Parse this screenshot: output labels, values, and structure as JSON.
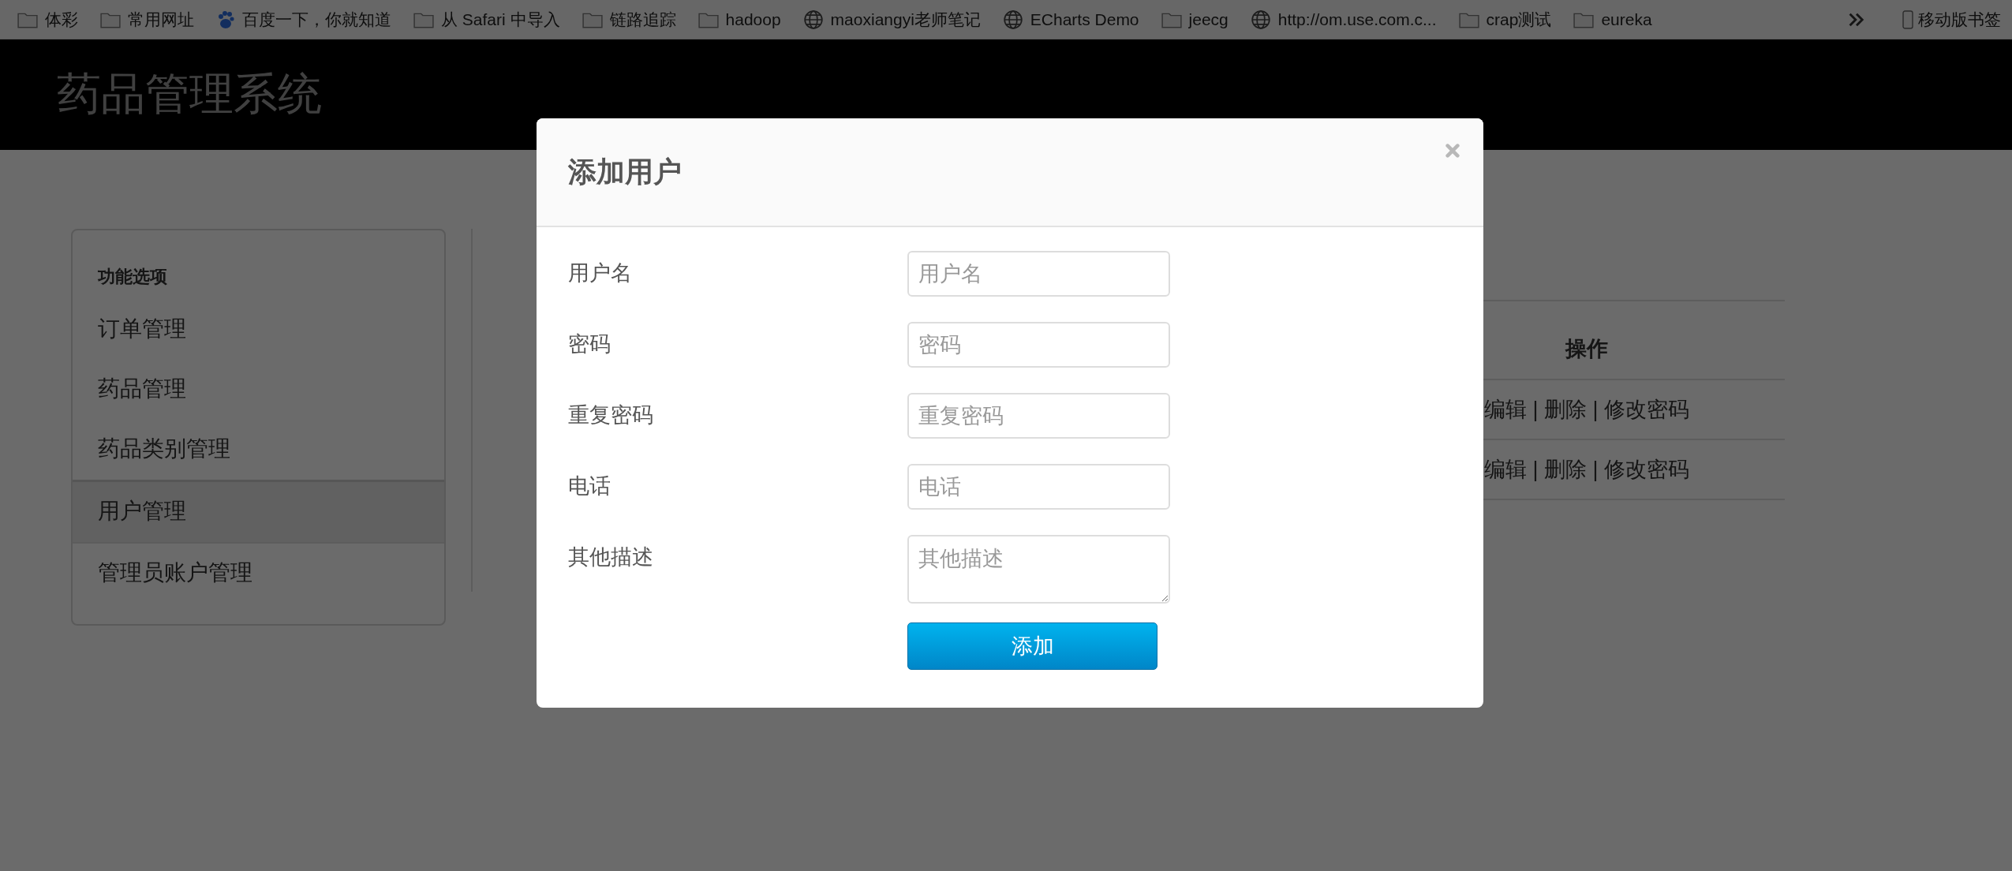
{
  "bookmarks": [
    {
      "kind": "folder",
      "label": "体彩"
    },
    {
      "kind": "folder",
      "label": "常用网址"
    },
    {
      "kind": "paw",
      "label": "百度一下，你就知道"
    },
    {
      "kind": "folder",
      "label": "从 Safari 中导入"
    },
    {
      "kind": "folder",
      "label": "链路追踪"
    },
    {
      "kind": "folder",
      "label": "hadoop"
    },
    {
      "kind": "globe",
      "label": "maoxiangyi老师笔记"
    },
    {
      "kind": "globe",
      "label": "ECharts Demo"
    },
    {
      "kind": "folder",
      "label": "jeecg"
    },
    {
      "kind": "globe",
      "label": "http://om.use.com.c..."
    },
    {
      "kind": "folder",
      "label": "crap测试"
    },
    {
      "kind": "folder",
      "label": "eureka"
    }
  ],
  "mobile_bookmarks": "移动版书签",
  "header": {
    "title": "药品管理系统"
  },
  "sidebar": {
    "heading": "功能选项",
    "items": [
      {
        "label": "订单管理",
        "selected": false
      },
      {
        "label": "药品管理",
        "selected": false
      },
      {
        "label": "药品类别管理",
        "selected": false
      },
      {
        "label": "用户管理",
        "selected": true
      },
      {
        "label": "管理员账户管理",
        "selected": false
      }
    ]
  },
  "table": {
    "columns": [
      "操作"
    ],
    "rows": [
      [
        "编辑 | 删除 | 修改密码"
      ],
      [
        "编辑 | 删除 | 修改密码"
      ]
    ]
  },
  "modal": {
    "title": "添加用户",
    "fields": [
      {
        "kind": "input",
        "label": "用户名",
        "placeholder": "用户名"
      },
      {
        "kind": "input",
        "label": "密码",
        "placeholder": "密码"
      },
      {
        "kind": "input",
        "label": "重复密码",
        "placeholder": "重复密码"
      },
      {
        "kind": "input",
        "label": "电话",
        "placeholder": "电话"
      },
      {
        "kind": "textarea",
        "label": "其他描述",
        "placeholder": "其他描述"
      }
    ],
    "submit": "添加"
  }
}
